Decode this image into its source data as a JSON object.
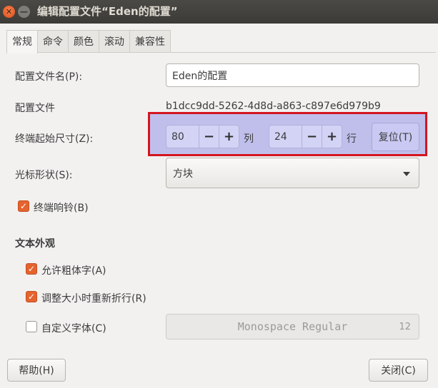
{
  "window": {
    "title": "编辑配置文件“Eden的配置”",
    "close_glyph": "✕",
    "minimize_glyph": "—"
  },
  "tabs": [
    "常规",
    "命令",
    "颜色",
    "滚动",
    "兼容性"
  ],
  "general": {
    "profile_name_label": "配置文件名(P):",
    "profile_name_value": "Eden的配置",
    "profile_id_label": "配置文件",
    "profile_id_value": "b1dcc9dd-5262-4d8d-a863-c897e6d979b9",
    "terminal_size_label": "终端起始尺寸(Z):",
    "columns_value": "80",
    "columns_unit": "列",
    "rows_value": "24",
    "rows_unit": "行",
    "minus_glyph": "−",
    "plus_glyph": "+",
    "reset_label": "复位(T)",
    "cursor_shape_label": "光标形状(S):",
    "cursor_shape_value": "方块",
    "terminal_bell_label": "终端响铃(B)",
    "terminal_bell_checked": true,
    "text_appearance_heading": "文本外观",
    "allow_bold_label": "允许粗体字(A)",
    "allow_bold_checked": true,
    "rewrap_label": "调整大小时重新折行(R)",
    "rewrap_checked": true,
    "custom_font_label": "自定义字体(C)",
    "custom_font_checked": false,
    "font_name": "Monospace Regular",
    "font_size": "12",
    "checkmark_glyph": "✓"
  },
  "footer": {
    "help_label": "帮助(H)",
    "close_label": "关闭(C)"
  },
  "colors": {
    "highlight_border": "#d4151f",
    "highlight_fill": "#8282e6",
    "checkbox_accent": "#e5632f",
    "titlebar": "#3c3b37"
  },
  "icons": {
    "close": "close-icon",
    "minimize": "minimize-icon",
    "dropdown": "chevron-down-icon",
    "check": "checkmark-icon"
  }
}
